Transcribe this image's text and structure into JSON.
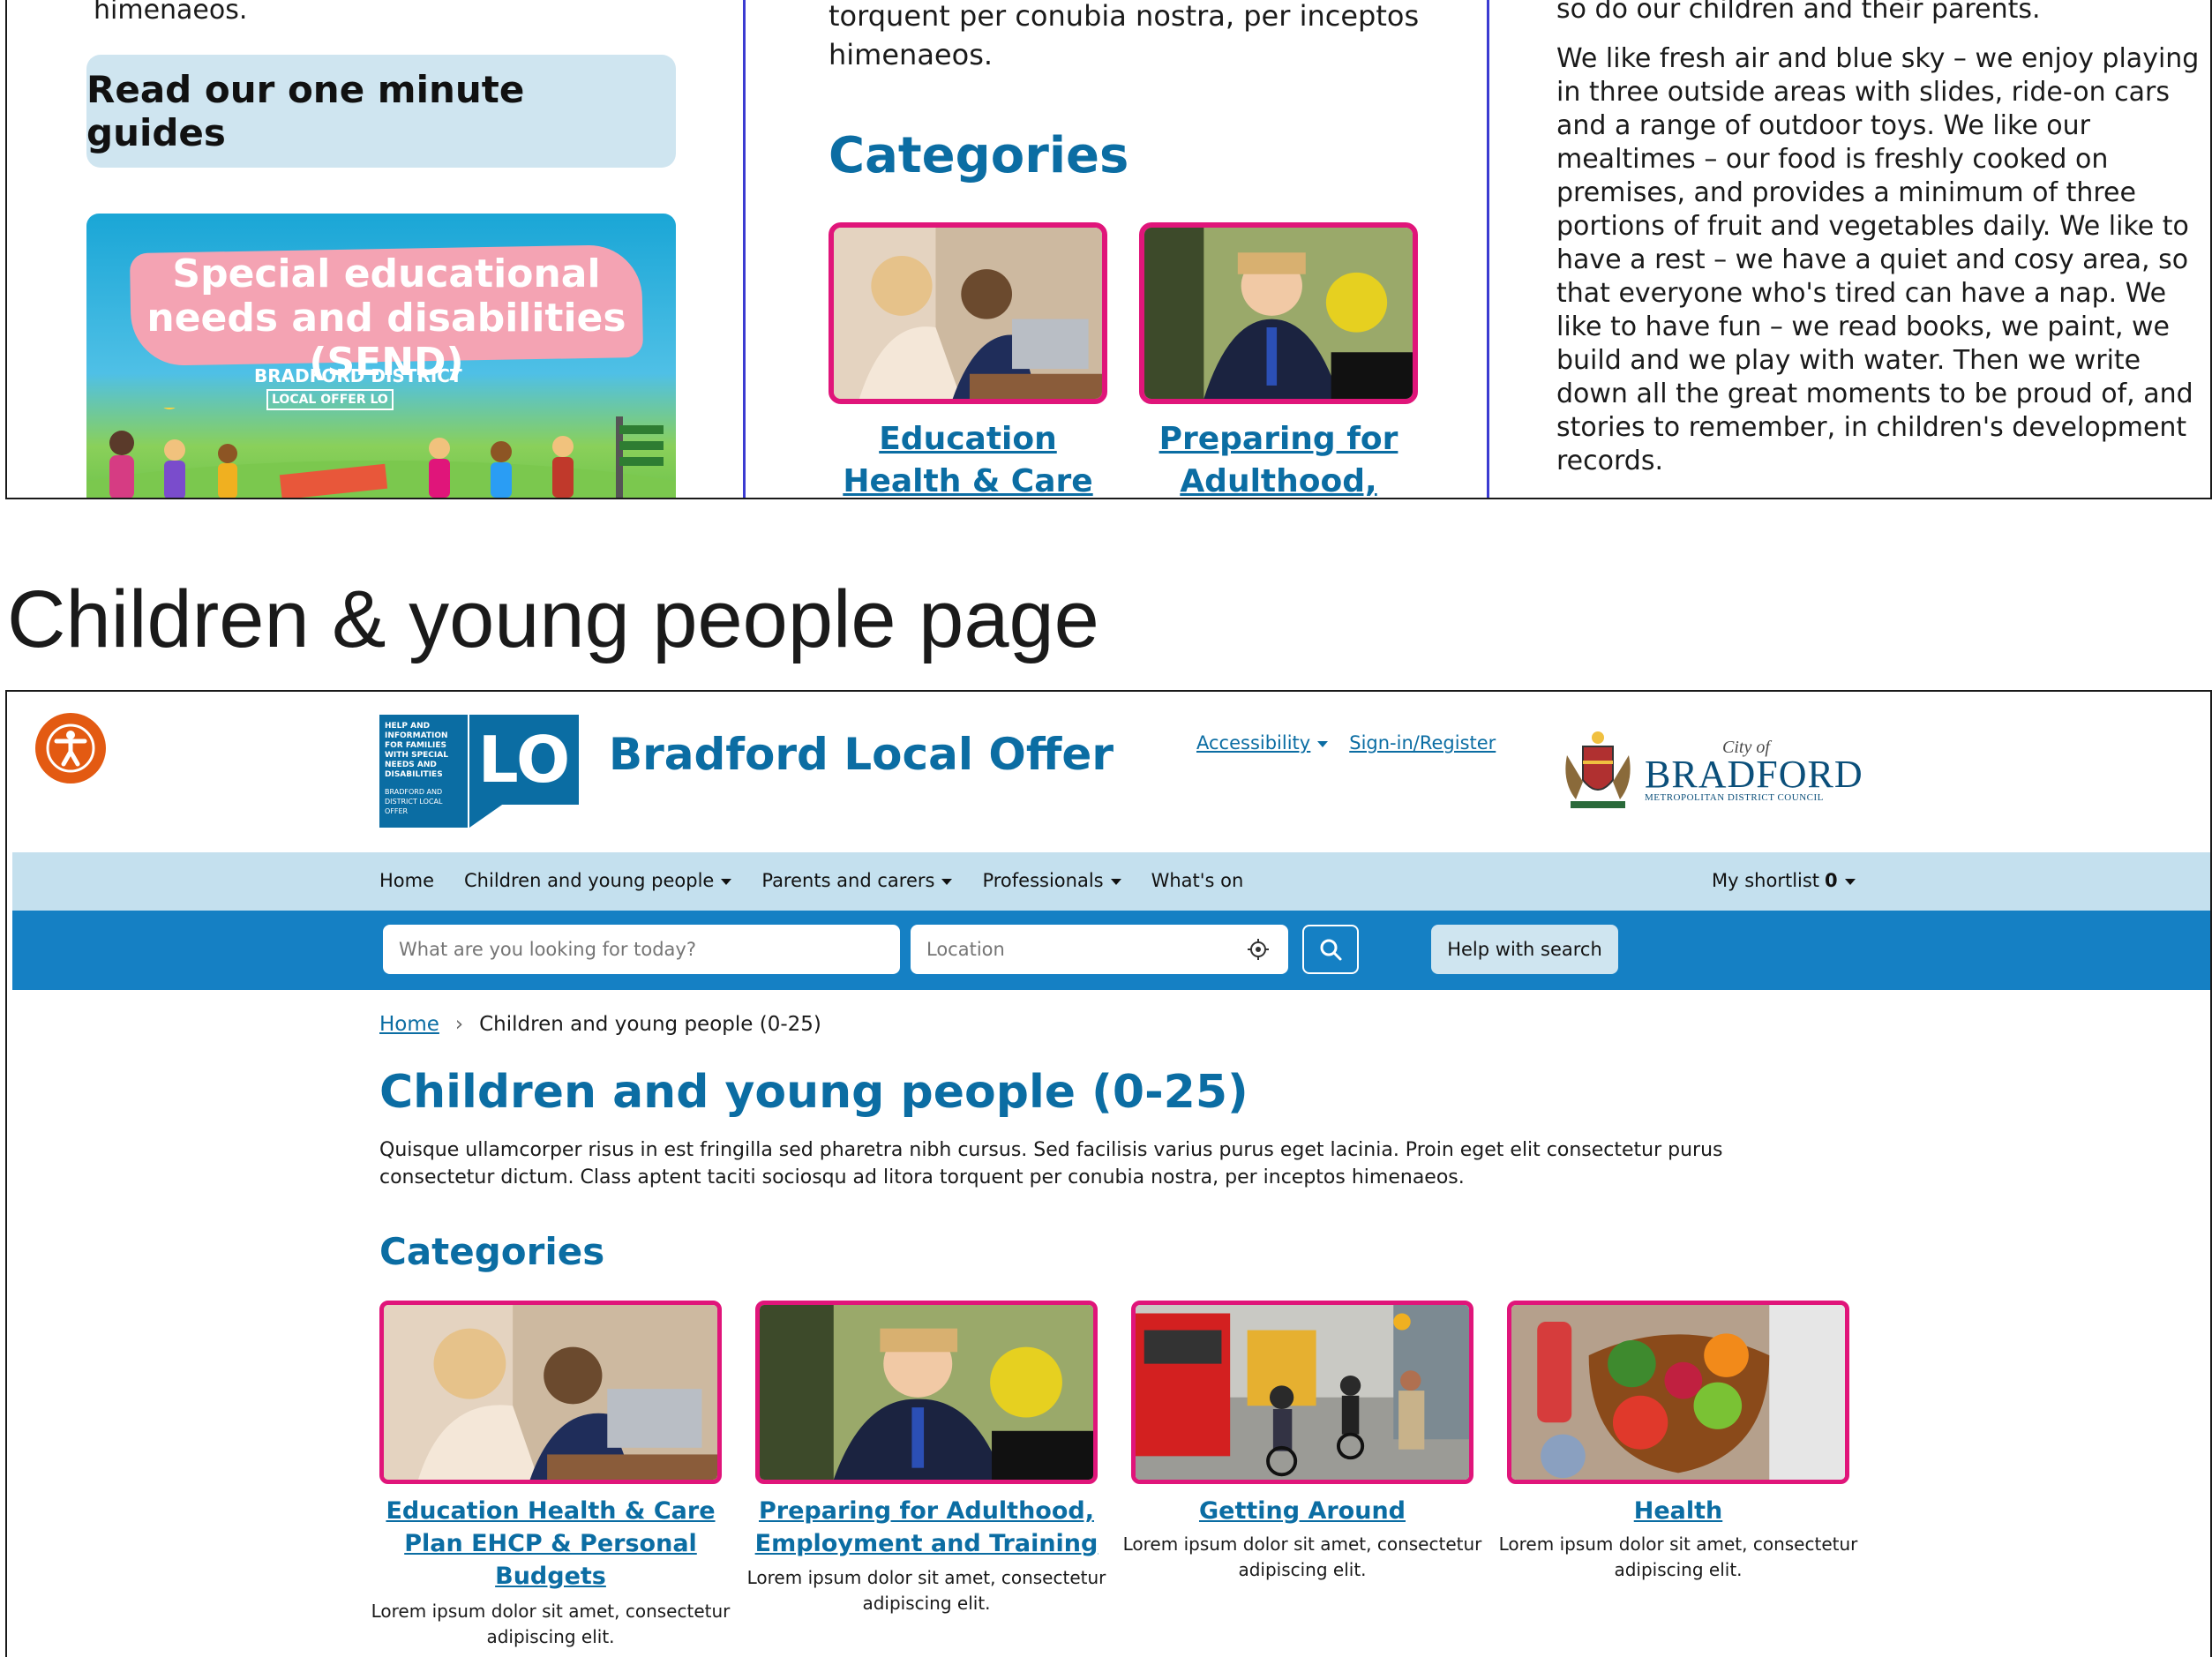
{
  "top_strip": {
    "left_tail_text": "himenaeos.",
    "guides_button": "Read our one minute guides",
    "send_banner": {
      "title": "Special educational needs and disabilities (SEND)",
      "subtitle": "BRADFORD DISTRICT",
      "badge": "LOCAL OFFER LO"
    },
    "middle_tail_text": "torquent per conubia nostra, per inceptos himenaeos.",
    "middle_categories_heading": "Categories",
    "middle_cards": [
      {
        "label": "Education Health & Care Plan EHCP"
      },
      {
        "label": "Preparing for Adulthood,"
      }
    ],
    "right_tail_text": "so do our children and their parents.",
    "right_paragraph": "We like fresh air and blue sky – we enjoy playing in three outside areas with slides, ride-on cars and a range of outdoor toys. We like our mealtimes – our food is freshly cooked on premises, and provides a minimum of three portions of fruit and vegetables daily. We like to have a rest – we have a quiet and cosy area, so that everyone who's tired can have a nap. We like to have fun – we read books, we paint, we build and we play with water. Then we write down all the great moments to be proud of, and stories to remember, in children's development records."
  },
  "section_heading": "Children & young people page",
  "header": {
    "logo_text": "HELP AND INFORMATION FOR FAMILIES WITH SPECIAL NEEDS AND DISABILITIES",
    "logo_small": "BRADFORD AND DISTRICT LOCAL OFFER",
    "logo_mark": "LO",
    "site_title": "Bradford Local Offer",
    "links": {
      "accessibility": "Accessibility",
      "sign_in": "Sign-in/Register"
    },
    "council": {
      "city_of": "City of",
      "name": "BRADFORD",
      "sub": "METROPOLITAN DISTRICT COUNCIL"
    }
  },
  "nav": {
    "home": "Home",
    "children": "Children and young people",
    "parents": "Parents and carers",
    "professionals": "Professionals",
    "whats_on": "What's on",
    "shortlist_label": "My shortlist",
    "shortlist_count": "0"
  },
  "search": {
    "query_placeholder": "What are you looking for today?",
    "location_placeholder": "Location",
    "help_label": "Help with search"
  },
  "breadcrumb": {
    "home": "Home",
    "separator": "›",
    "current": "Children and young people (0-25)"
  },
  "page": {
    "title": "Children and young people (0-25)",
    "description": "Quisque ullamcorper risus in est fringilla sed pharetra nibh cursus. Sed facilisis varius purus eget lacinia. Proin eget elit consectetur purus consectetur dictum. Class aptent taciti sociosqu ad litora torquent per conubia nostra, per inceptos himenaeos.",
    "categories_heading": "Categories"
  },
  "categories": [
    {
      "title": "Education Health & Care Plan EHCP & Personal Budgets",
      "desc": "Lorem ipsum dolor sit amet, consectetur adipiscing elit."
    },
    {
      "title": "Preparing for Adulthood, Employment and Training",
      "desc": "Lorem ipsum dolor sit amet, consectetur adipiscing elit."
    },
    {
      "title": "Getting Around",
      "desc": "Lorem ipsum dolor sit amet, consectetur adipiscing elit."
    },
    {
      "title": "Health",
      "desc": "Lorem ipsum dolor sit amet, consectetur adipiscing elit."
    }
  ],
  "colors": {
    "brand_blue": "#0b6da3",
    "nav_light": "#c4e0ee",
    "search_bar": "#1580c4",
    "card_border": "#e0157a",
    "a11y_orange": "#e35a12"
  },
  "icons": [
    "accessibility-icon",
    "locate-icon",
    "search-icon",
    "caret-down-icon",
    "breadcrumb-chevron-icon"
  ]
}
